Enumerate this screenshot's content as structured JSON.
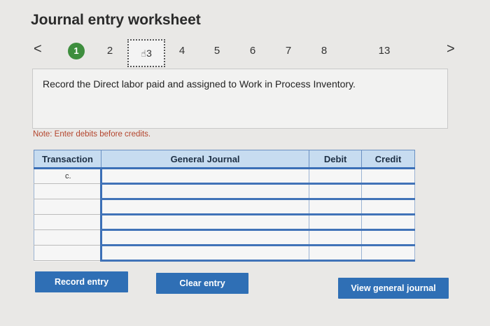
{
  "worksheet": {
    "title": "Journal entry worksheet",
    "prev_arrow": "<",
    "next_arrow": ">",
    "pages": [
      "1",
      "2",
      "3",
      "4",
      "5",
      "6",
      "7",
      "8",
      "13"
    ],
    "active_page": "1",
    "current_page": "3"
  },
  "prompt": {
    "text": "Record the Direct labor paid and assigned to Work in Process Inventory."
  },
  "note": "Note: Enter debits before credits.",
  "journal": {
    "columns": [
      "Transaction",
      "General Journal",
      "Debit",
      "Credit"
    ],
    "rows": [
      {
        "transaction": "c.",
        "account": "",
        "debit": "",
        "credit": ""
      },
      {
        "transaction": "",
        "account": "",
        "debit": "",
        "credit": ""
      },
      {
        "transaction": "",
        "account": "",
        "debit": "",
        "credit": ""
      },
      {
        "transaction": "",
        "account": "",
        "debit": "",
        "credit": ""
      },
      {
        "transaction": "",
        "account": "",
        "debit": "",
        "credit": ""
      },
      {
        "transaction": "",
        "account": "",
        "debit": "",
        "credit": ""
      }
    ]
  },
  "buttons": {
    "record": "Record entry",
    "clear": "Clear entry",
    "view": "View general journal"
  },
  "colors": {
    "active_page": "#3e8e3e",
    "button": "#2f6fb5",
    "header": "#c7dcf0",
    "note": "#b3442c"
  }
}
